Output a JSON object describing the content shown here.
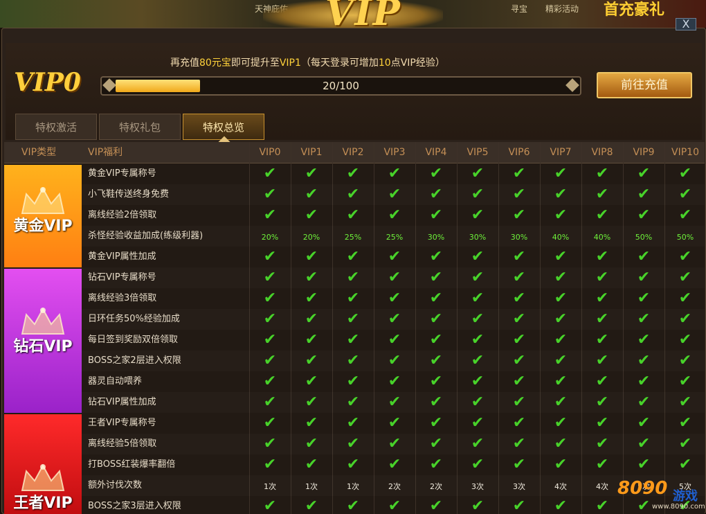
{
  "top_strip": {
    "items": [
      "天神庇佑",
      "寻宝",
      "精彩活动"
    ],
    "gift_text": "首充豪礼"
  },
  "logo_text": "VIP",
  "close_label": "X",
  "header": {
    "current_level": "VIP0",
    "message_parts": [
      "再充值",
      "80元宝",
      "即可提升至",
      "VIP1",
      "（每天登录可增加",
      "10",
      "点VIP经验）"
    ],
    "progress_value": 20,
    "progress_max": 100,
    "progress_text": "20/100",
    "recharge_button": "前往充值"
  },
  "tabs": [
    {
      "label": "特权激活",
      "active": false
    },
    {
      "label": "特权礼包",
      "active": false
    },
    {
      "label": "特权总览",
      "active": true
    }
  ],
  "table": {
    "col_type": "VIP类型",
    "col_benefit": "VIP福利",
    "levels": [
      "VIP0",
      "VIP1",
      "VIP2",
      "VIP3",
      "VIP4",
      "VIP5",
      "VIP6",
      "VIP7",
      "VIP8",
      "VIP9",
      "VIP10"
    ],
    "tiers": [
      {
        "name": "黄金VIP",
        "color_top": "#ffb21c",
        "color_bottom": "#ff7f12"
      },
      {
        "name": "钻石VIP",
        "color_top": "#e34ff0",
        "color_bottom": "#9a22c9"
      },
      {
        "name": "王者VIP",
        "color_top": "#ff2a2a",
        "color_bottom": "#c10d10"
      }
    ],
    "rows": [
      {
        "label": "黄金VIP专属称号",
        "cells": [
          "✔",
          "✔",
          "✔",
          "✔",
          "✔",
          "✔",
          "✔",
          "✔",
          "✔",
          "✔",
          "✔"
        ]
      },
      {
        "label": "小飞鞋传送终身免费",
        "cells": [
          "✔",
          "✔",
          "✔",
          "✔",
          "✔",
          "✔",
          "✔",
          "✔",
          "✔",
          "✔",
          "✔"
        ]
      },
      {
        "label": "离线经验2倍领取",
        "cells": [
          "✔",
          "✔",
          "✔",
          "✔",
          "✔",
          "✔",
          "✔",
          "✔",
          "✔",
          "✔",
          "✔"
        ]
      },
      {
        "label": "杀怪经验收益加成(练级利器)",
        "cells": [
          "20%",
          "20%",
          "25%",
          "25%",
          "30%",
          "30%",
          "30%",
          "40%",
          "40%",
          "50%",
          "50%"
        ]
      },
      {
        "label": "黄金VIP属性加成",
        "cells": [
          "✔",
          "✔",
          "✔",
          "✔",
          "✔",
          "✔",
          "✔",
          "✔",
          "✔",
          "✔",
          "✔"
        ]
      },
      {
        "label": "钻石VIP专属称号",
        "cells": [
          "✔",
          "✔",
          "✔",
          "✔",
          "✔",
          "✔",
          "✔",
          "✔",
          "✔",
          "✔",
          "✔"
        ]
      },
      {
        "label": "离线经验3倍领取",
        "cells": [
          "✔",
          "✔",
          "✔",
          "✔",
          "✔",
          "✔",
          "✔",
          "✔",
          "✔",
          "✔",
          "✔"
        ]
      },
      {
        "label": "日环任务50%经验加成",
        "cells": [
          "✔",
          "✔",
          "✔",
          "✔",
          "✔",
          "✔",
          "✔",
          "✔",
          "✔",
          "✔",
          "✔"
        ]
      },
      {
        "label": "每日签到奖励双倍领取",
        "cells": [
          "✔",
          "✔",
          "✔",
          "✔",
          "✔",
          "✔",
          "✔",
          "✔",
          "✔",
          "✔",
          "✔"
        ]
      },
      {
        "label": "BOSS之家2层进入权限",
        "cells": [
          "✔",
          "✔",
          "✔",
          "✔",
          "✔",
          "✔",
          "✔",
          "✔",
          "✔",
          "✔",
          "✔"
        ]
      },
      {
        "label": "器灵自动喂养",
        "cells": [
          "✔",
          "✔",
          "✔",
          "✔",
          "✔",
          "✔",
          "✔",
          "✔",
          "✔",
          "✔",
          "✔"
        ]
      },
      {
        "label": "钻石VIP属性加成",
        "cells": [
          "✔",
          "✔",
          "✔",
          "✔",
          "✔",
          "✔",
          "✔",
          "✔",
          "✔",
          "✔",
          "✔"
        ]
      },
      {
        "label": "王者VIP专属称号",
        "cells": [
          "✔",
          "✔",
          "✔",
          "✔",
          "✔",
          "✔",
          "✔",
          "✔",
          "✔",
          "✔",
          "✔"
        ]
      },
      {
        "label": "离线经验5倍领取",
        "cells": [
          "✔",
          "✔",
          "✔",
          "✔",
          "✔",
          "✔",
          "✔",
          "✔",
          "✔",
          "✔",
          "✔"
        ]
      },
      {
        "label": "打BOSS红装爆率翻倍",
        "cells": [
          "✔",
          "✔",
          "✔",
          "✔",
          "✔",
          "✔",
          "✔",
          "✔",
          "✔",
          "✔",
          "✔"
        ]
      },
      {
        "label": "额外讨伐次数",
        "cells": [
          "1次",
          "1次",
          "1次",
          "2次",
          "2次",
          "3次",
          "3次",
          "4次",
          "4次",
          "5次",
          "5次"
        ]
      },
      {
        "label": "BOSS之家3层进入权限",
        "cells": [
          "✔",
          "✔",
          "✔",
          "✔",
          "✔",
          "✔",
          "✔",
          "✔",
          "✔",
          "✔",
          "✔"
        ]
      }
    ]
  },
  "watermark": {
    "num": "8090",
    "brand": "游戏",
    "url": "www.8090.com"
  }
}
